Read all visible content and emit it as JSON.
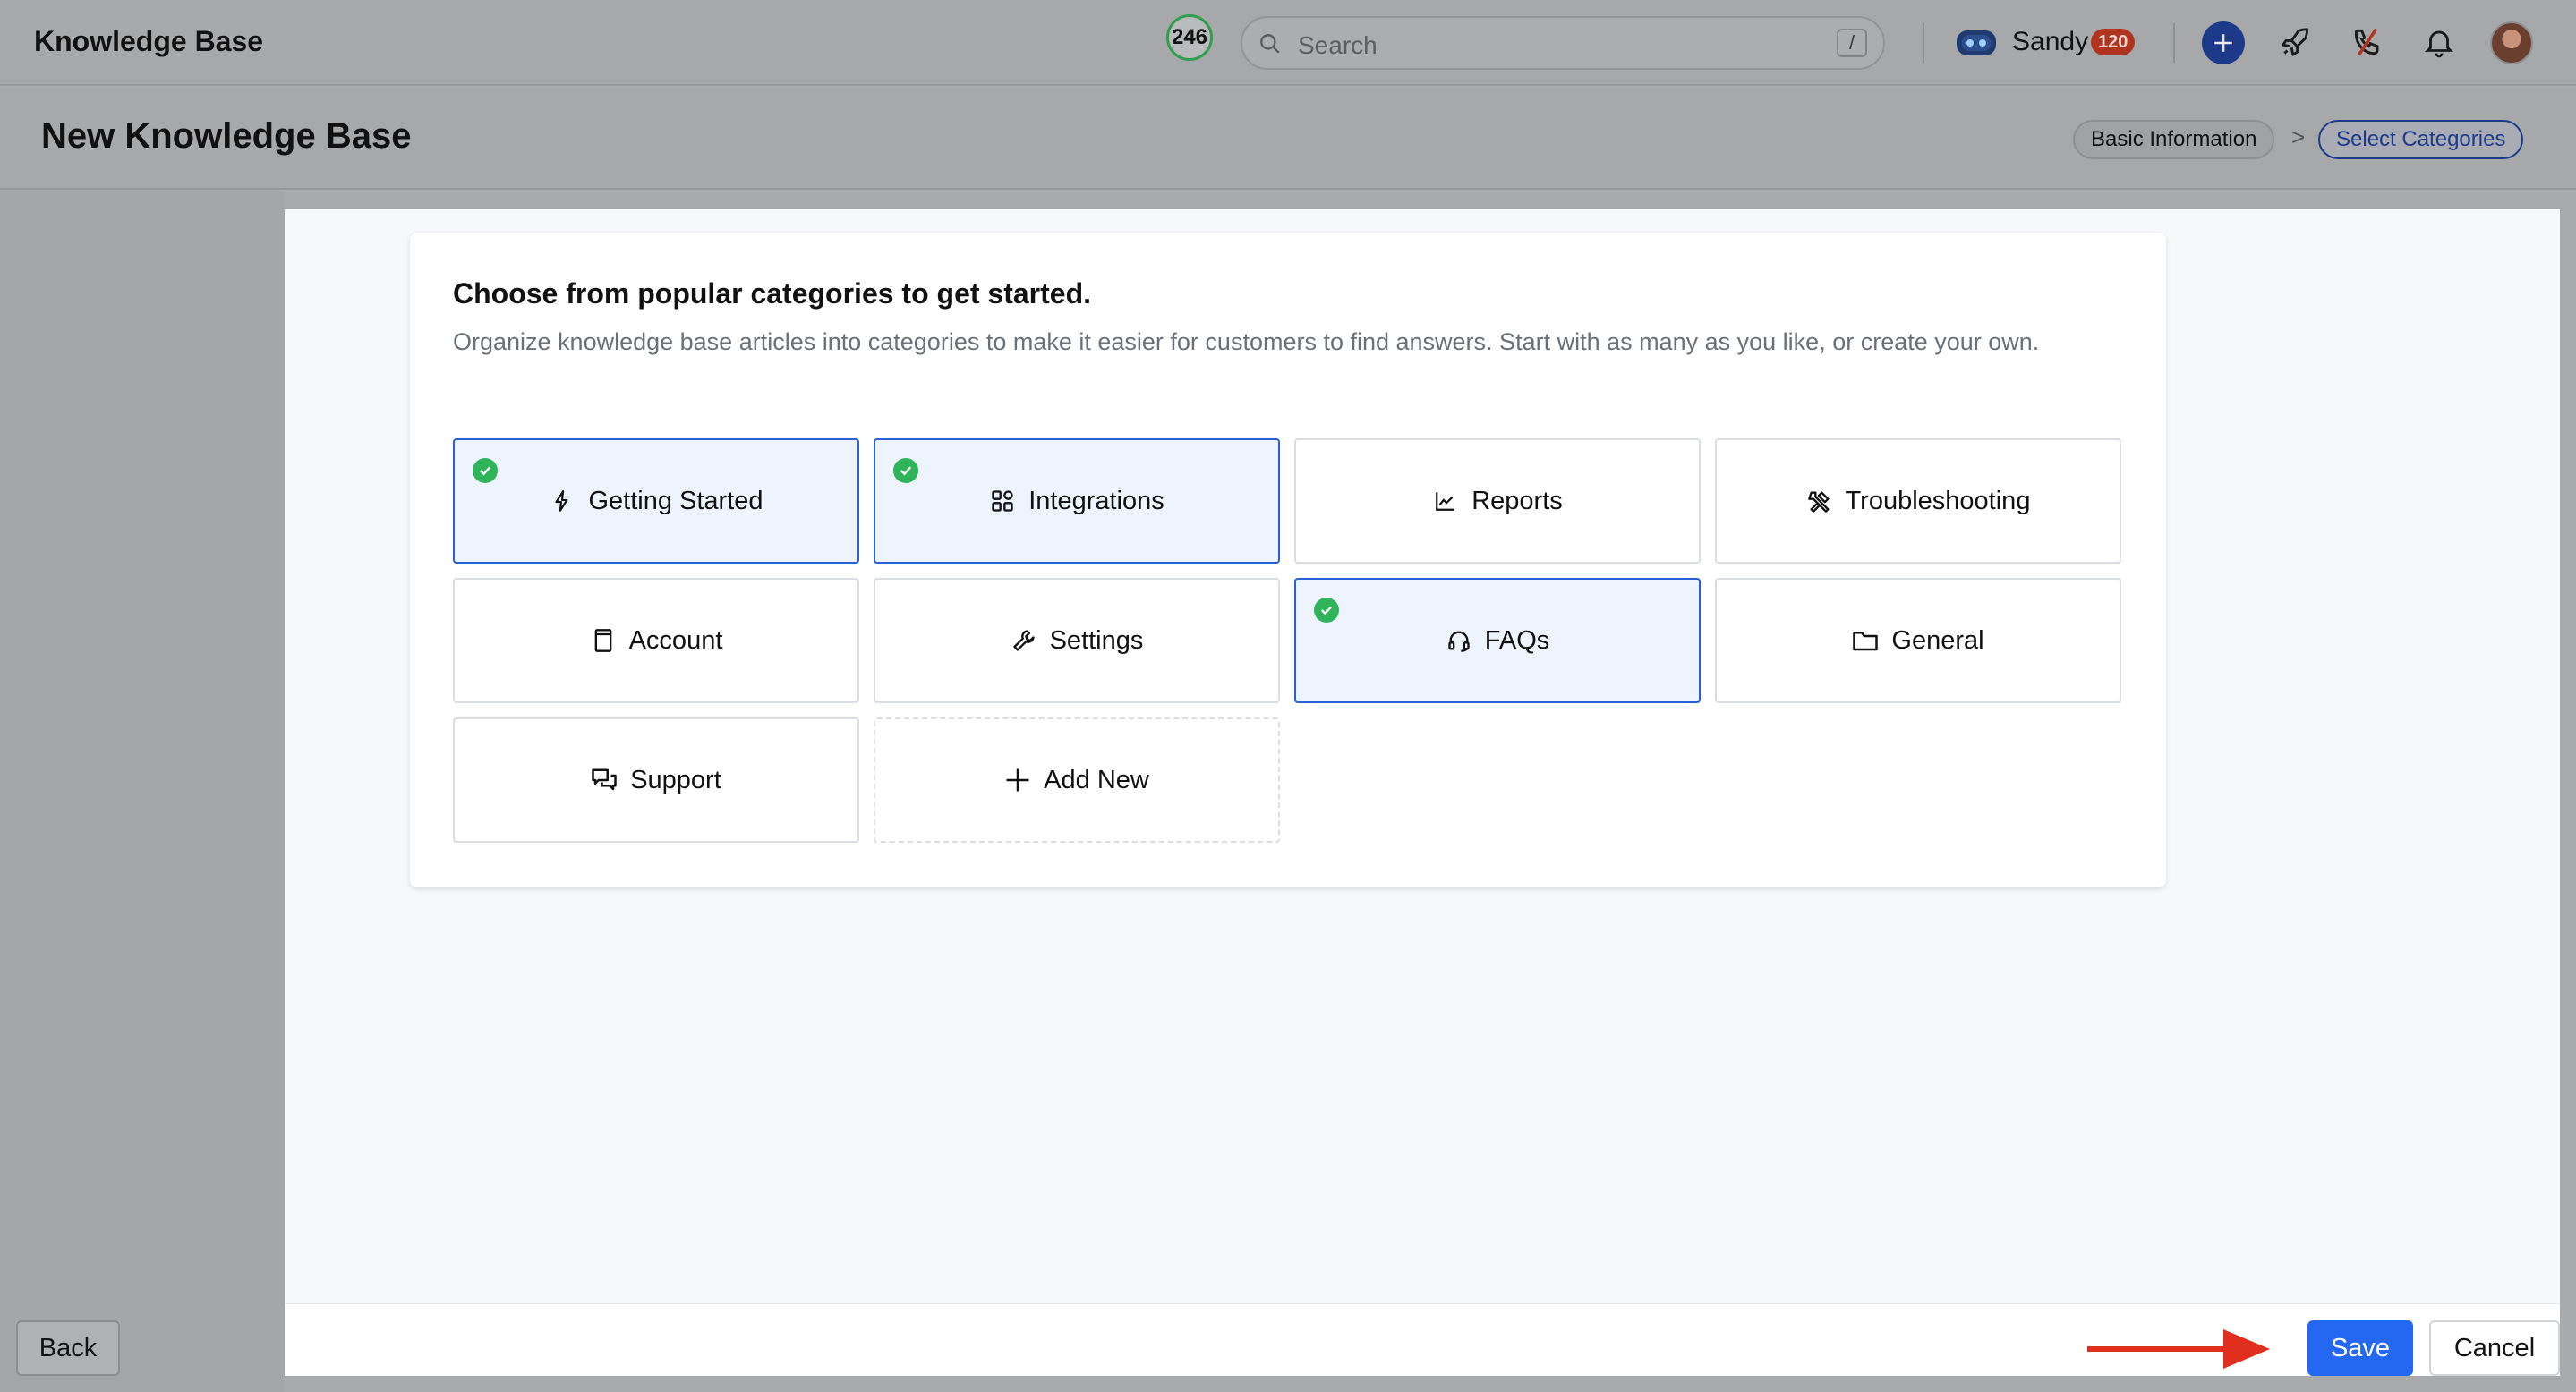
{
  "header": {
    "app_title": "Knowledge Base",
    "counter": "246",
    "search_placeholder": "Search",
    "search_shortcut": "/",
    "user_name": "Sandy",
    "user_badge": "120"
  },
  "subheader": {
    "page_title": "New Knowledge Base",
    "steps": [
      {
        "label": "Basic Information",
        "active": false
      },
      {
        "label": "Select Categories",
        "active": true
      }
    ],
    "step_separator": ">"
  },
  "card": {
    "title": "Choose from popular categories to get started.",
    "description": "Organize knowledge base articles into categories to make it easier for customers to find answers. Start with as many as you like, or create your own."
  },
  "categories": [
    {
      "label": "Getting Started",
      "icon": "lightning-icon",
      "selected": true
    },
    {
      "label": "Integrations",
      "icon": "grid-apps-icon",
      "selected": true
    },
    {
      "label": "Reports",
      "icon": "chart-line-icon",
      "selected": false
    },
    {
      "label": "Troubleshooting",
      "icon": "tools-icon",
      "selected": false
    },
    {
      "label": "Account",
      "icon": "book-icon",
      "selected": false
    },
    {
      "label": "Settings",
      "icon": "wrench-icon",
      "selected": false
    },
    {
      "label": "FAQs",
      "icon": "headset-icon",
      "selected": true
    },
    {
      "label": "General",
      "icon": "folder-icon",
      "selected": false
    },
    {
      "label": "Support",
      "icon": "chat-bubbles-icon",
      "selected": false
    },
    {
      "label": "Add New",
      "icon": "plus-icon",
      "selected": false
    }
  ],
  "footer": {
    "back_label": "Back",
    "save_label": "Save",
    "cancel_label": "Cancel"
  },
  "colors": {
    "accent": "#2468f2",
    "selected_border": "#2a5fd6",
    "selected_bg": "#eef4fe",
    "check_green": "#2fb45a",
    "annotation_arrow": "#e02f1f"
  }
}
